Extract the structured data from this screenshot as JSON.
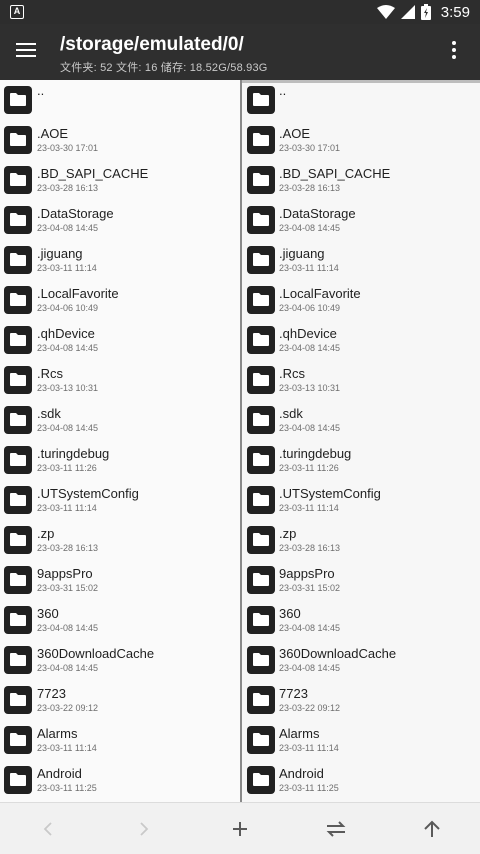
{
  "statusbar": {
    "time": "3:59",
    "app_badge": "A"
  },
  "appbar": {
    "path": "/storage/emulated/0/",
    "stats": "文件夹: 52  文件: 16  储存: 18.52G/58.93G"
  },
  "parent_entry": "..",
  "files": [
    {
      "name": ".AOE",
      "date": "23-03-30 17:01"
    },
    {
      "name": ".BD_SAPI_CACHE",
      "date": "23-03-28 16:13"
    },
    {
      "name": ".DataStorage",
      "date": "23-04-08 14:45"
    },
    {
      "name": ".jiguang",
      "date": "23-03-11 11:14"
    },
    {
      "name": ".LocalFavorite",
      "date": "23-04-06 10:49"
    },
    {
      "name": ".qhDevice",
      "date": "23-04-08 14:45"
    },
    {
      "name": ".Rcs",
      "date": "23-03-13 10:31"
    },
    {
      "name": ".sdk",
      "date": "23-04-08 14:45"
    },
    {
      "name": ".turingdebug",
      "date": "23-03-11 11:26"
    },
    {
      "name": ".UTSystemConfig",
      "date": "23-03-11 11:14"
    },
    {
      "name": ".zp",
      "date": "23-03-28 16:13"
    },
    {
      "name": "9appsPro",
      "date": "23-03-31 15:02"
    },
    {
      "name": "360",
      "date": "23-04-08 14:45"
    },
    {
      "name": "360DownloadCache",
      "date": "23-04-08 14:45"
    },
    {
      "name": "7723",
      "date": "23-03-22 09:12"
    },
    {
      "name": "Alarms",
      "date": "23-03-11 11:14"
    },
    {
      "name": "Android",
      "date": "23-03-11 11:25"
    }
  ],
  "bottombar": {
    "back_icon": "chevron-left",
    "forward_icon": "chevron-right",
    "add_icon": "plus",
    "swap_icon": "swap-arrows",
    "up_icon": "arrow-up"
  },
  "colors": {
    "appbar": "#2f2f2f",
    "folder": "#212121",
    "background": "#fafafa"
  }
}
